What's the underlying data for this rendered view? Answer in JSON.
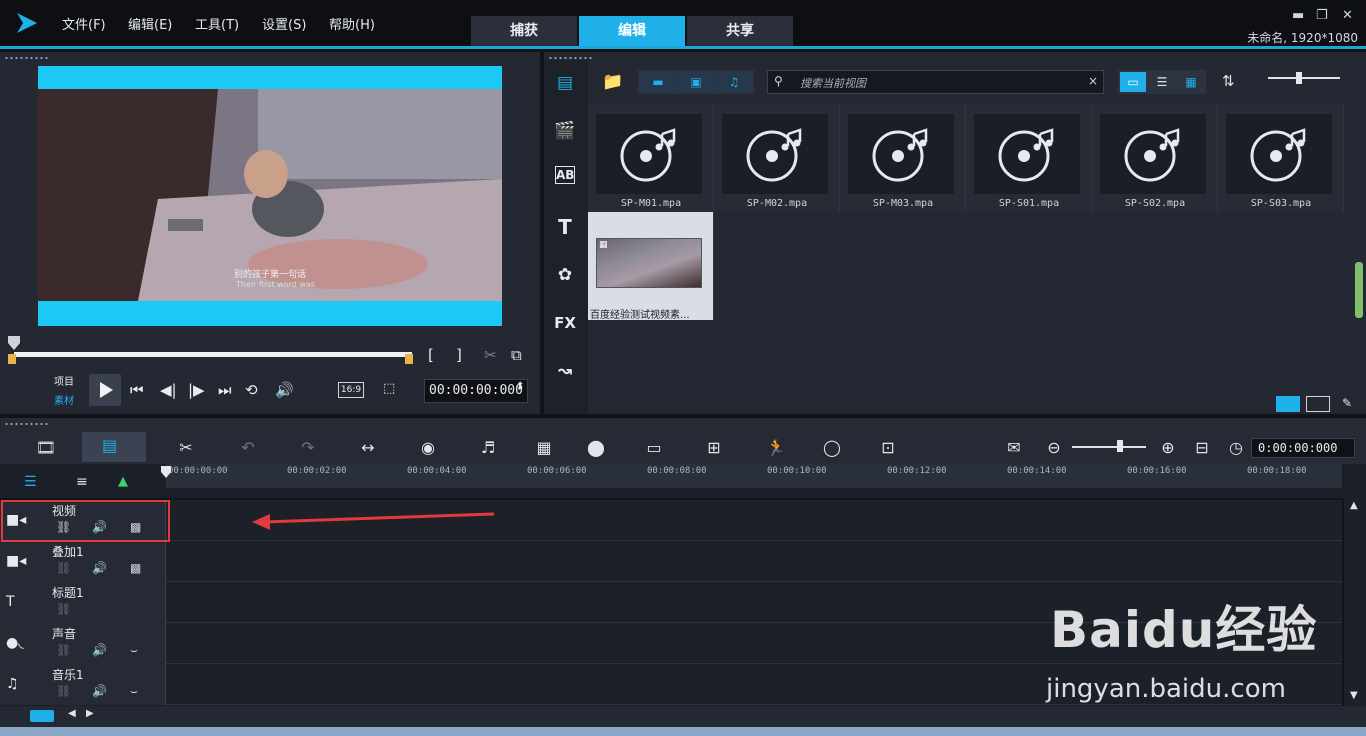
{
  "menu": [
    "文件(F)",
    "编辑(E)",
    "工具(T)",
    "设置(S)",
    "帮助(H)"
  ],
  "tabs": [
    {
      "label": "捕获",
      "active": false
    },
    {
      "label": "编辑",
      "active": true
    },
    {
      "label": "共享",
      "active": false
    }
  ],
  "window": {
    "min": "▬",
    "restore": "❐",
    "close": "✕"
  },
  "project_info": "未命名, 1920*1080",
  "preview": {
    "subtitle_cn": "别的孩子第一句话",
    "subtitle_en": "Their first word was",
    "mode_project": "项目",
    "mode_clip": "素材",
    "aspect": "16:9",
    "timecode": "00:00:00:000"
  },
  "library": {
    "search_placeholder": "搜索当前视图",
    "items": [
      {
        "name": "SP-M01.mpa"
      },
      {
        "name": "SP-M02.mpa"
      },
      {
        "name": "SP-M03.mpa"
      },
      {
        "name": "SP-S01.mpa"
      },
      {
        "name": "SP-S02.mpa"
      },
      {
        "name": "SP-S03.mpa"
      }
    ],
    "video_item": "百度经验测试视频素...",
    "side_icons": [
      "media-icon",
      "instant-project-icon",
      "transition-icon",
      "title-icon",
      "graphic-icon",
      "filter-icon",
      "path-icon"
    ],
    "side_labels": {
      "transition": "AB",
      "title": "T",
      "filter": "FX"
    }
  },
  "timeline": {
    "timecode": "0:00:00:000",
    "ruler": [
      "00:00:00:00",
      "00:00:02:00",
      "00:00:04:00",
      "00:00:06:00",
      "00:00:08:00",
      "00:00:10:00",
      "00:00:12:00",
      "00:00:14:00",
      "00:00:16:00",
      "00:00:18:00"
    ],
    "tracks": [
      {
        "name": "视频"
      },
      {
        "name": "叠加1"
      },
      {
        "name": "标题1"
      },
      {
        "name": "声音"
      },
      {
        "name": "音乐1"
      }
    ]
  },
  "watermark": {
    "brand": "Baidu经验",
    "url": "jingyan.baidu.com"
  },
  "colors": {
    "accent": "#1fb0ea",
    "highlight": "#e03a3a",
    "panel": "#232833"
  }
}
